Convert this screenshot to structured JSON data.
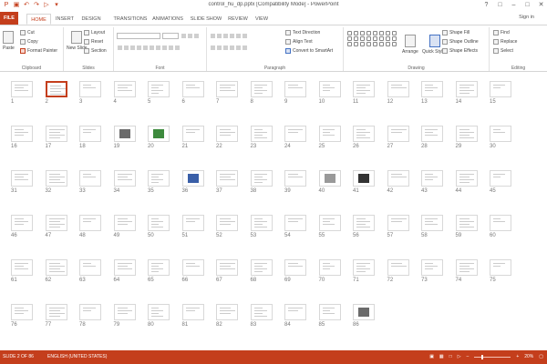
{
  "app": {
    "title": "control_hu_dp.pptx [Compatibility Mode] - PowerPoint",
    "accent": "#c43e1c",
    "signin": "Sign in"
  },
  "quick_access": [
    "save-icon",
    "undo-icon",
    "redo-icon",
    "present-icon",
    "customize-icon"
  ],
  "tabs": [
    "FILE",
    "HOME",
    "INSERT",
    "DESIGN",
    "TRANSITIONS",
    "ANIMATIONS",
    "SLIDE SHOW",
    "REVIEW",
    "VIEW"
  ],
  "ribbon": {
    "clipboard": {
      "paste": "Paste",
      "cut": "Cut",
      "copy": "Copy",
      "format_painter": "Format Painter",
      "label": "Clipboard"
    },
    "slides": {
      "new_slide": "New Slide",
      "layout": "Layout",
      "reset": "Reset",
      "section": "Section",
      "label": "Slides"
    },
    "font": {
      "label": "Font"
    },
    "paragraph": {
      "text_direction": "Text Direction",
      "align_text": "Align Text",
      "convert_smartart": "Convert to SmartArt",
      "label": "Paragraph"
    },
    "drawing": {
      "arrange": "Arrange",
      "quick_styles": "Quick Styles",
      "shape_fill": "Shape Fill",
      "shape_outline": "Shape Outline",
      "shape_effects": "Shape Effects",
      "label": "Drawing"
    },
    "editing": {
      "find": "Find",
      "replace": "Replace",
      "select": "Select",
      "label": "Editing"
    }
  },
  "slides": {
    "count": 86,
    "selected": 2,
    "image_slides": {
      "19": "photo",
      "20": "green",
      "36": "blue",
      "40": "sketch",
      "41": "dark",
      "86": "photo"
    }
  },
  "status": {
    "slide_info": "SLIDE 2 OF 86",
    "language": "ENGLISH (UNITED STATES)",
    "zoom": "20%",
    "zoom_level": 0.2
  }
}
